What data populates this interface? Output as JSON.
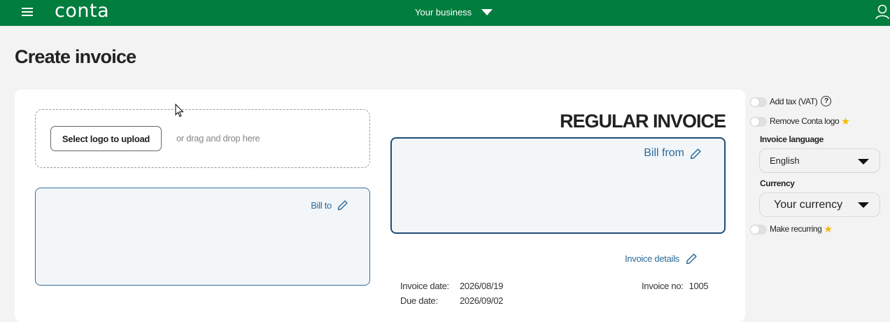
{
  "topbar": {
    "brand": "conta",
    "business_label": "Your business",
    "icons": {
      "menu": "hamburger-menu-icon",
      "user": "user-icon",
      "caret": "caret-down-icon"
    },
    "color": "#017d3e"
  },
  "page": {
    "title": "Create invoice"
  },
  "logo_upload": {
    "button_label": "Select logo to upload",
    "hint": "or drag and drop here"
  },
  "invoice": {
    "heading": "REGULAR INVOICE",
    "bill_to_label": "Bill to",
    "bill_from_label": "Bill from",
    "details_label": "Invoice details",
    "invoice_date_label": "Invoice date:",
    "invoice_date": "2026/08/19",
    "due_date_label": "Due date:",
    "due_date": "2026/09/02",
    "invoice_no_label": "Invoice no:",
    "invoice_no": "1005"
  },
  "options": {
    "add_tax_label": "Add tax (VAT)",
    "add_tax_on": false,
    "remove_logo_label": "Remove Conta logo",
    "remove_logo_on": false,
    "language_label": "Invoice language",
    "language_value": "English",
    "currency_label": "Currency",
    "currency_value": "Your currency",
    "recurring_label": "Make recurring",
    "recurring_on": false,
    "icons": {
      "help": "question-circle-icon",
      "premium": "star-icon",
      "edit": "pencil-icon"
    },
    "accent": "#f5b800",
    "link_color": "#2e6a97"
  }
}
